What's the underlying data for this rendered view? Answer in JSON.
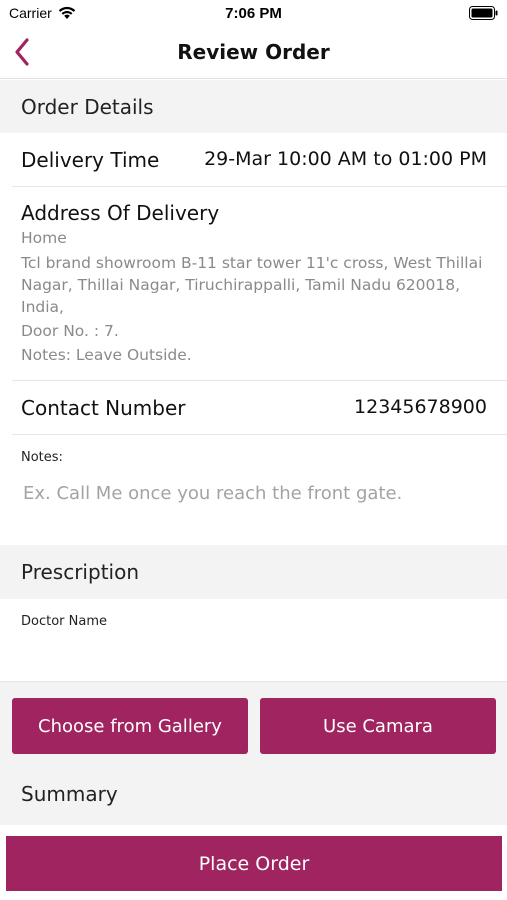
{
  "status_bar": {
    "carrier": "Carrier",
    "time": "7:06 PM"
  },
  "nav": {
    "title": "Review Order",
    "back_icon": "chevron-left-icon"
  },
  "order_details": {
    "header": "Order Details",
    "delivery_time_label": "Delivery Time",
    "delivery_time_value": "29-Mar 10:00 AM to 01:00 PM",
    "address_label": "Address Of Delivery",
    "address_type": "Home",
    "address_line1": "Tcl brand showroom B-11 star tower 11'c cross, West Thillai",
    "address_line2": "Nagar, Thillai Nagar, Tiruchirappalli, Tamil Nadu 620018,",
    "address_line3": "India,",
    "door_no": "Door No. : 7.",
    "address_notes": "Notes: Leave Outside.",
    "contact_label": "Contact Number",
    "contact_value": "12345678900",
    "notes_label": "Notes:",
    "notes_placeholder": "Ex. Call Me once you reach the front gate."
  },
  "prescription": {
    "header": "Prescription",
    "doctor_label": "Doctor Name",
    "gallery_button": "Choose from Gallery",
    "camera_button": "Use Camara"
  },
  "summary": {
    "header": "Summary"
  },
  "place_order_button": "Place Order",
  "colors": {
    "accent": "#a0245f",
    "section_bg": "#f3f3f3"
  }
}
